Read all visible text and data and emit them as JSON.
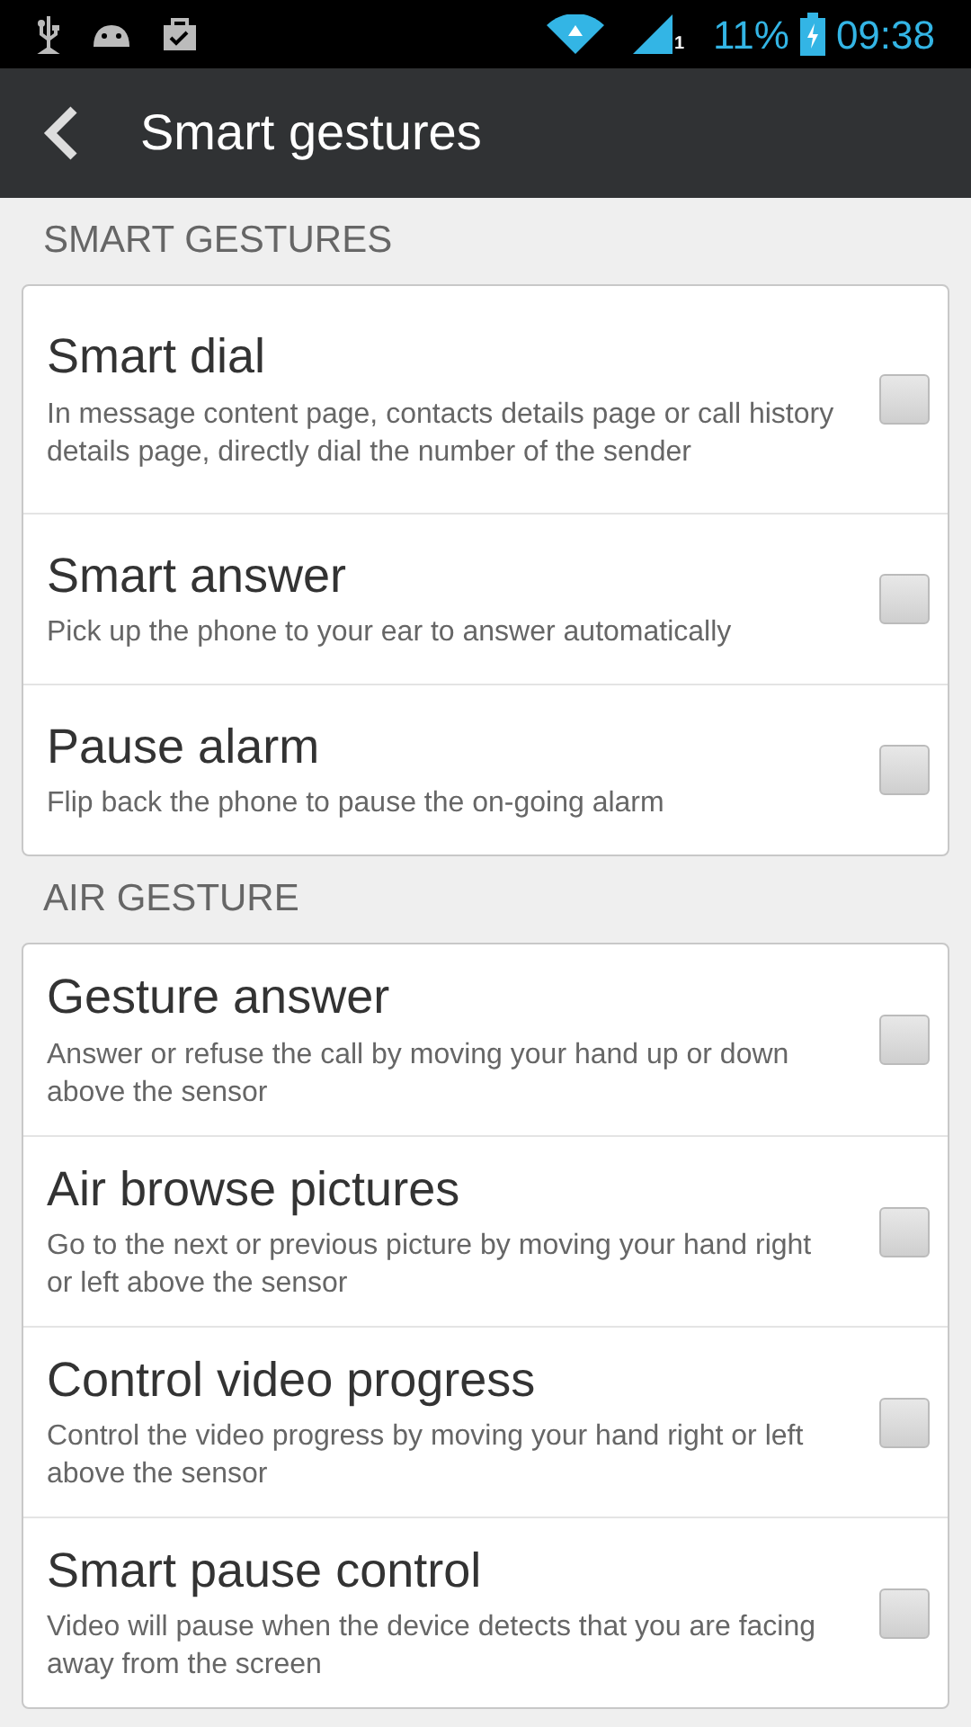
{
  "status_bar": {
    "sim_slot": "1",
    "battery": "11%",
    "time": "09:38"
  },
  "action_bar": {
    "title": "Smart gestures"
  },
  "sections": [
    {
      "header": "SMART GESTURES",
      "items": [
        {
          "title": "Smart dial",
          "description": "In message content page, contacts details page or call history details page, directly dial the number of the sender",
          "checked": false
        },
        {
          "title": "Smart answer",
          "description": "Pick up the phone to your ear to answer automatically",
          "checked": false
        },
        {
          "title": "Pause alarm",
          "description": "Flip back the phone to pause the on-going alarm",
          "checked": false
        }
      ]
    },
    {
      "header": "AIR GESTURE",
      "items": [
        {
          "title": "Gesture answer",
          "description": "Answer or refuse the call by moving your hand up or down above the sensor",
          "checked": false
        },
        {
          "title": "Air browse pictures",
          "description": "Go to the next or previous picture by moving your hand right or left above the sensor",
          "checked": false
        },
        {
          "title": "Control video progress",
          "description": "Control the video progress by moving your hand right or left above the sensor",
          "checked": false
        },
        {
          "title": "Smart pause control",
          "description": "Video will pause when the device detects that you are facing away from the screen",
          "checked": false
        }
      ]
    }
  ]
}
